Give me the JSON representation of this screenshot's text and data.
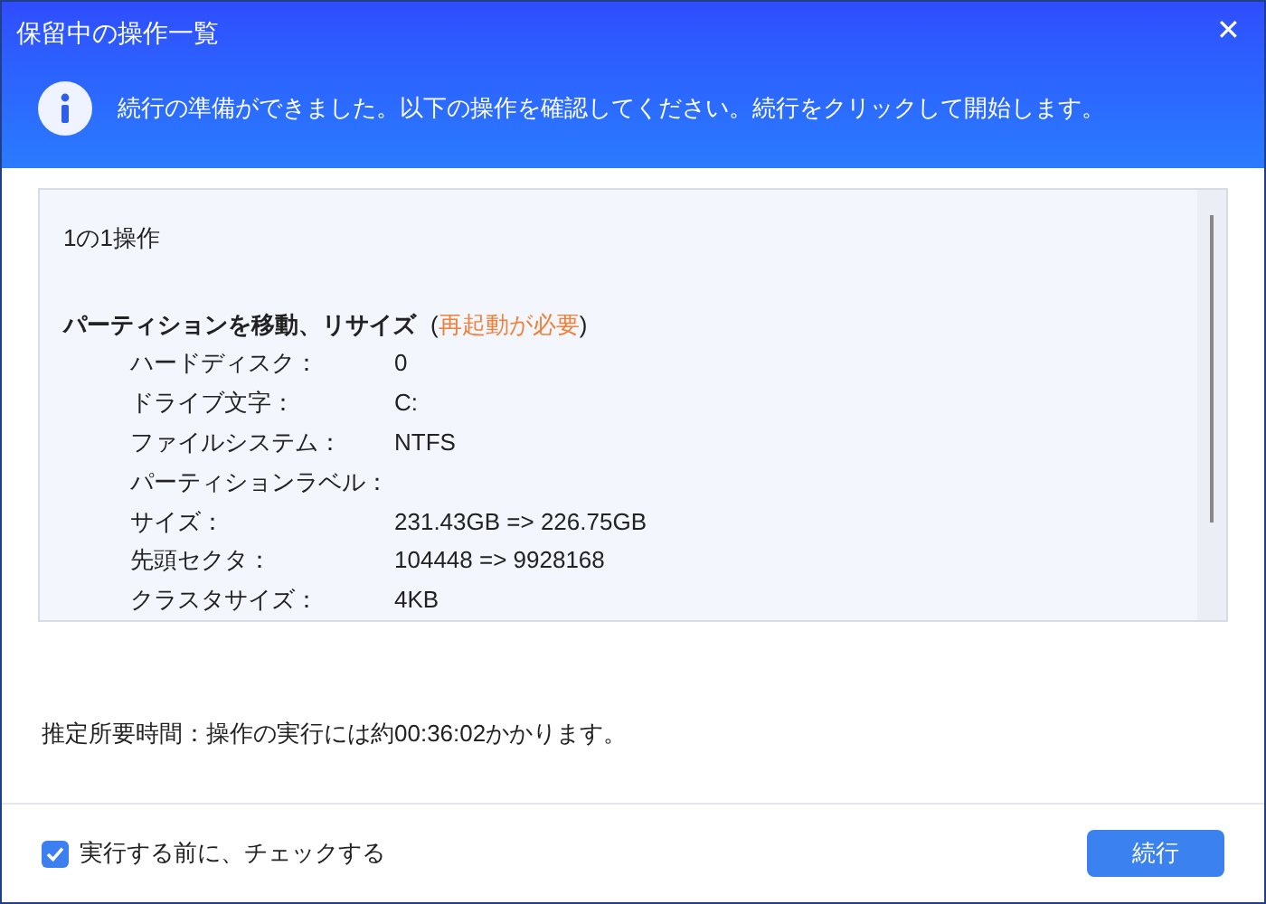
{
  "window": {
    "title": "保留中の操作一覧",
    "close": "✕"
  },
  "banner": {
    "message": "続行の準備ができました。以下の操作を確認してください。続行をクリックして開始します。"
  },
  "operations": {
    "count": "1の1操作",
    "title": "パーティションを移動、リサイズ",
    "note": {
      "open": "(",
      "text": "再起動が必要",
      "close": ")"
    },
    "details": [
      {
        "label": "ハードディスク：",
        "value": "0"
      },
      {
        "label": "ドライブ文字：",
        "value": "C:"
      },
      {
        "label": "ファイルシステム：",
        "value": "NTFS"
      },
      {
        "label": "パーティションラベル："
      },
      {
        "label": "サイズ：",
        "value": "231.43GB => 226.75GB"
      },
      {
        "label": "先頭セクタ：",
        "value": "104448 => 9928168"
      },
      {
        "label": "クラスタサイズ：",
        "value": "4KB"
      }
    ]
  },
  "estimate": "推定所要時間：操作の実行には約00:36:02かかります。",
  "check_before": {
    "label": "実行する前に、チェックする",
    "checked": true
  },
  "continue_button": "続行"
}
